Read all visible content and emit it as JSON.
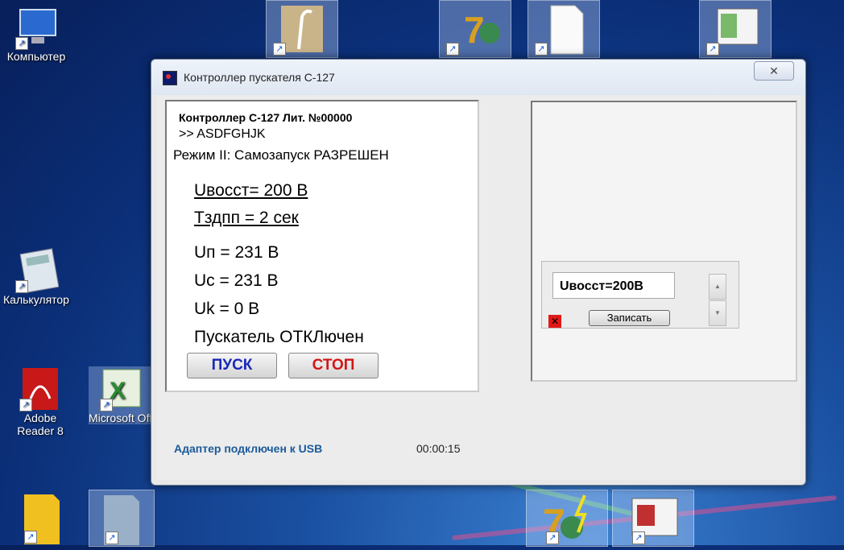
{
  "desktop": {
    "icons": [
      {
        "label": "Компьютер",
        "icon": "computer-icon"
      },
      {
        "label": "Калькулятор",
        "icon": "calculator-icon"
      },
      {
        "label": "Adobe Reader 8",
        "icon": "pdf-icon"
      },
      {
        "label": "Microsoft Office Ex",
        "icon": "excel-icon"
      }
    ],
    "shortcut_glyph": "↗"
  },
  "window": {
    "title": "Контроллер пускателя С-127",
    "close_glyph": "✕",
    "display": {
      "header": "Контроллер С-127  Лит. №00000",
      "code_line": ">> ASDFGHJK",
      "mode": "Режим II: Самозапуск РАЗРЕШЕН",
      "u_restore": "Uвосст= 200 В",
      "t_delay": "Тздпп = 2 сек",
      "u_p": "Uп = 231 В",
      "u_c": "Uc = 231 В",
      "u_k": "Uk = 0 B",
      "starter_state": "Пускатель ОТКЛючен"
    },
    "buttons": {
      "start": "ПУСК",
      "stop": "СТОП"
    },
    "status": "Адаптер подключен к USB",
    "timer": "00:00:15",
    "editor": {
      "value": "Uвосст=200В",
      "save_label": "Записать",
      "spin_up": "▲",
      "spin_down": "▼",
      "error_glyph": "✕"
    }
  }
}
